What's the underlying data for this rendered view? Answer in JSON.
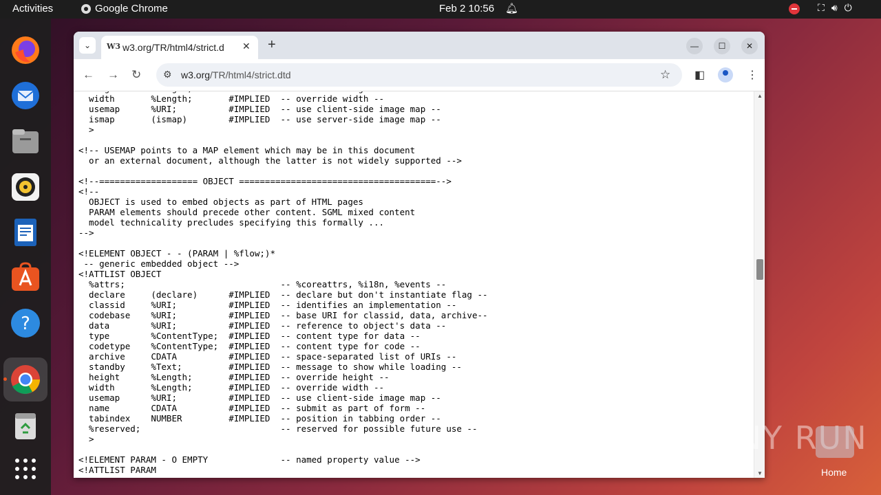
{
  "topbar": {
    "activities": "Activities",
    "app_name": "Google Chrome",
    "clock": "Feb 2  10:56"
  },
  "dock": {
    "items": [
      "firefox-icon",
      "thunderbird-icon",
      "files-icon",
      "rhythmbox-icon",
      "libreoffice-writer-icon",
      "app-center-icon",
      "help-icon",
      "chrome-icon",
      "trash-icon",
      "show-apps-icon"
    ]
  },
  "browser": {
    "tab_title": "w3.org/TR/html4/strict.d",
    "favicon": "W3",
    "url_host": "w3.org",
    "url_path": "/TR/html4/strict.dtd"
  },
  "page": {
    "text": "  height      %Length;       #IMPLIED  -- override height --\n  width       %Length;       #IMPLIED  -- override width --\n  usemap      %URI;          #IMPLIED  -- use client-side image map --\n  ismap       (ismap)        #IMPLIED  -- use server-side image map --\n  >\n\n<!-- USEMAP points to a MAP element which may be in this document\n  or an external document, although the latter is not widely supported -->\n\n<!--=================== OBJECT ======================================-->\n<!--\n  OBJECT is used to embed objects as part of HTML pages\n  PARAM elements should precede other content. SGML mixed content\n  model technicality precludes specifying this formally ...\n-->\n\n<!ELEMENT OBJECT - - (PARAM | %flow;)*\n -- generic embedded object -->\n<!ATTLIST OBJECT\n  %attrs;                              -- %coreattrs, %i18n, %events --\n  declare     (declare)      #IMPLIED  -- declare but don't instantiate flag --\n  classid     %URI;          #IMPLIED  -- identifies an implementation --\n  codebase    %URI;          #IMPLIED  -- base URI for classid, data, archive--\n  data        %URI;          #IMPLIED  -- reference to object's data --\n  type        %ContentType;  #IMPLIED  -- content type for data --\n  codetype    %ContentType;  #IMPLIED  -- content type for code --\n  archive     CDATA          #IMPLIED  -- space-separated list of URIs --\n  standby     %Text;         #IMPLIED  -- message to show while loading --\n  height      %Length;       #IMPLIED  -- override height --\n  width       %Length;       #IMPLIED  -- override width --\n  usemap      %URI;          #IMPLIED  -- use client-side image map --\n  name        CDATA          #IMPLIED  -- submit as part of form --\n  tabindex    NUMBER         #IMPLIED  -- position in tabbing order --\n  %reserved;                           -- reserved for possible future use --\n  >\n\n<!ELEMENT PARAM - O EMPTY              -- named property value -->\n<!ATTLIST PARAM"
  },
  "desktop": {
    "watermark": "ANY RUN",
    "home_label": "Home"
  },
  "colors": {
    "accent": "#e95420",
    "topbar": "#1d1d1d"
  }
}
